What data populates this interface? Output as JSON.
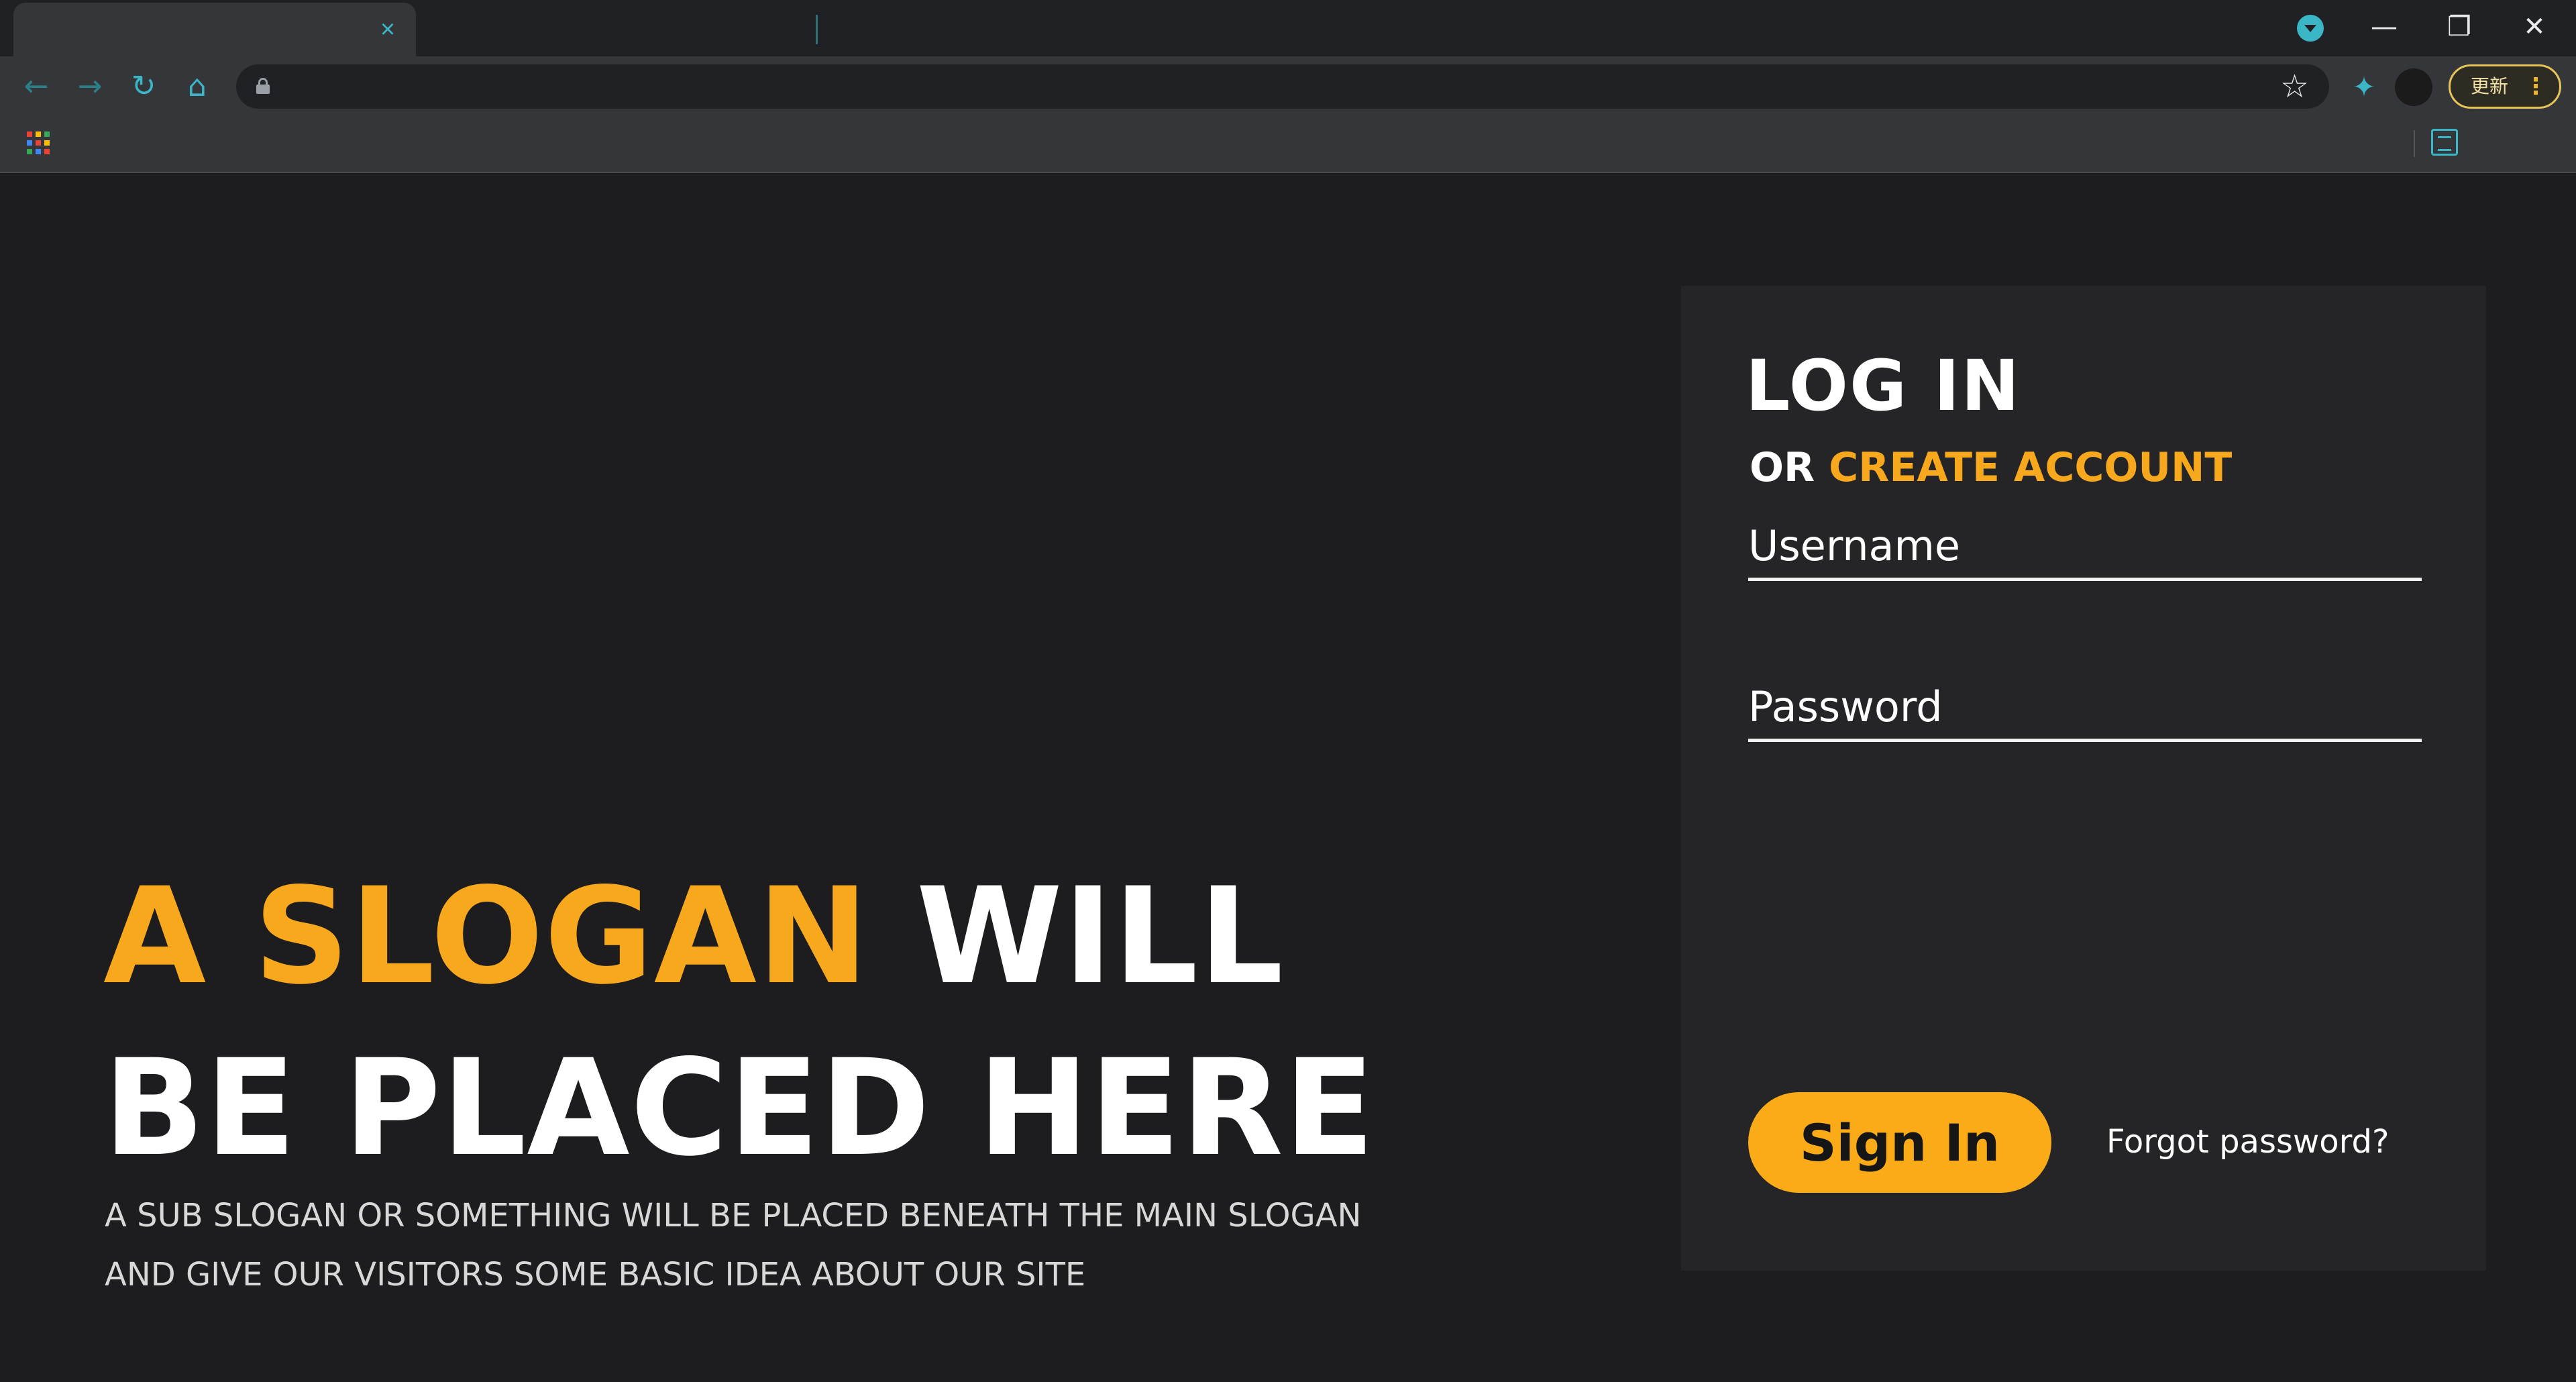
{
  "browser": {
    "tab_close": "×",
    "window_controls": {
      "minimize": "—",
      "maximize": "❐",
      "close": "✕"
    },
    "nav": {
      "back": "←",
      "forward": "→",
      "reload": "↻",
      "home": "⌂"
    },
    "bookmark_star": "☆",
    "extensions": "✦",
    "update_button": "更新",
    "update_menu": "⋮",
    "icons": [
      "tab-close-icon",
      "profile-dropdown-icon",
      "back-icon",
      "forward-icon",
      "reload-icon",
      "home-icon",
      "lock-icon",
      "star-icon",
      "extensions-icon",
      "apps-icon",
      "reading-list-icon"
    ],
    "accent_color": "#3bb6c6",
    "apps_colors": [
      "#ea4335",
      "#fbbc05",
      "#34a853",
      "#4285f4",
      "#ea4335",
      "#fbbc05",
      "#34a853",
      "#4285f4",
      "#ea4335"
    ]
  },
  "hero": {
    "slogan_accent": "A SLOGAN",
    "slogan_rest_1": " WILL",
    "slogan_line_2": "BE PLACED HERE",
    "sub_line_1": "A SUB SLOGAN OR SOMETHING WILL BE PLACED BENEATH THE MAIN SLOGAN",
    "sub_line_2": "AND GIVE OUR VISITORS SOME BASIC IDEA ABOUT OUR SITE",
    "accent_color": "#f8a81c"
  },
  "login": {
    "title": "LOG IN",
    "or_text": "OR ",
    "create_account": "CREATE ACCOUNT",
    "username_placeholder": "Username",
    "password_placeholder": "Password",
    "sign_in": "Sign In",
    "forgot_password": "Forgot password?",
    "button_color": "#fbab18"
  }
}
